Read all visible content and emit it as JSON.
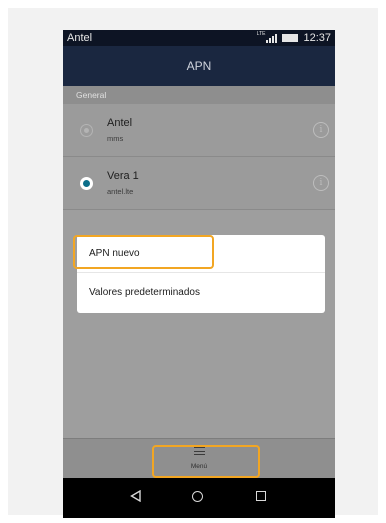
{
  "status_bar": {
    "carrier": "Antel",
    "network": "LTE",
    "time": "12:37"
  },
  "app_bar": {
    "title": "APN"
  },
  "section": {
    "label": "General"
  },
  "apn_list": [
    {
      "name": "Antel",
      "apn": "mms",
      "selected": false
    },
    {
      "name": "Vera 1",
      "apn": "antel.lte",
      "selected": true
    }
  ],
  "info_icon_glyph": "i",
  "dialog": {
    "items": [
      "APN nuevo",
      "Valores predeterminados"
    ]
  },
  "bottom_bar": {
    "menu_label": "Menú"
  },
  "colors": {
    "highlight": "#f2a623",
    "app_bar": "#1a2740",
    "radio_selected": "#0b6e8a"
  },
  "icons": {
    "menu": "hamburger-icon",
    "info": "info-icon",
    "back": "back-triangle-icon",
    "home": "home-circle-icon",
    "recent": "recent-square-icon"
  }
}
